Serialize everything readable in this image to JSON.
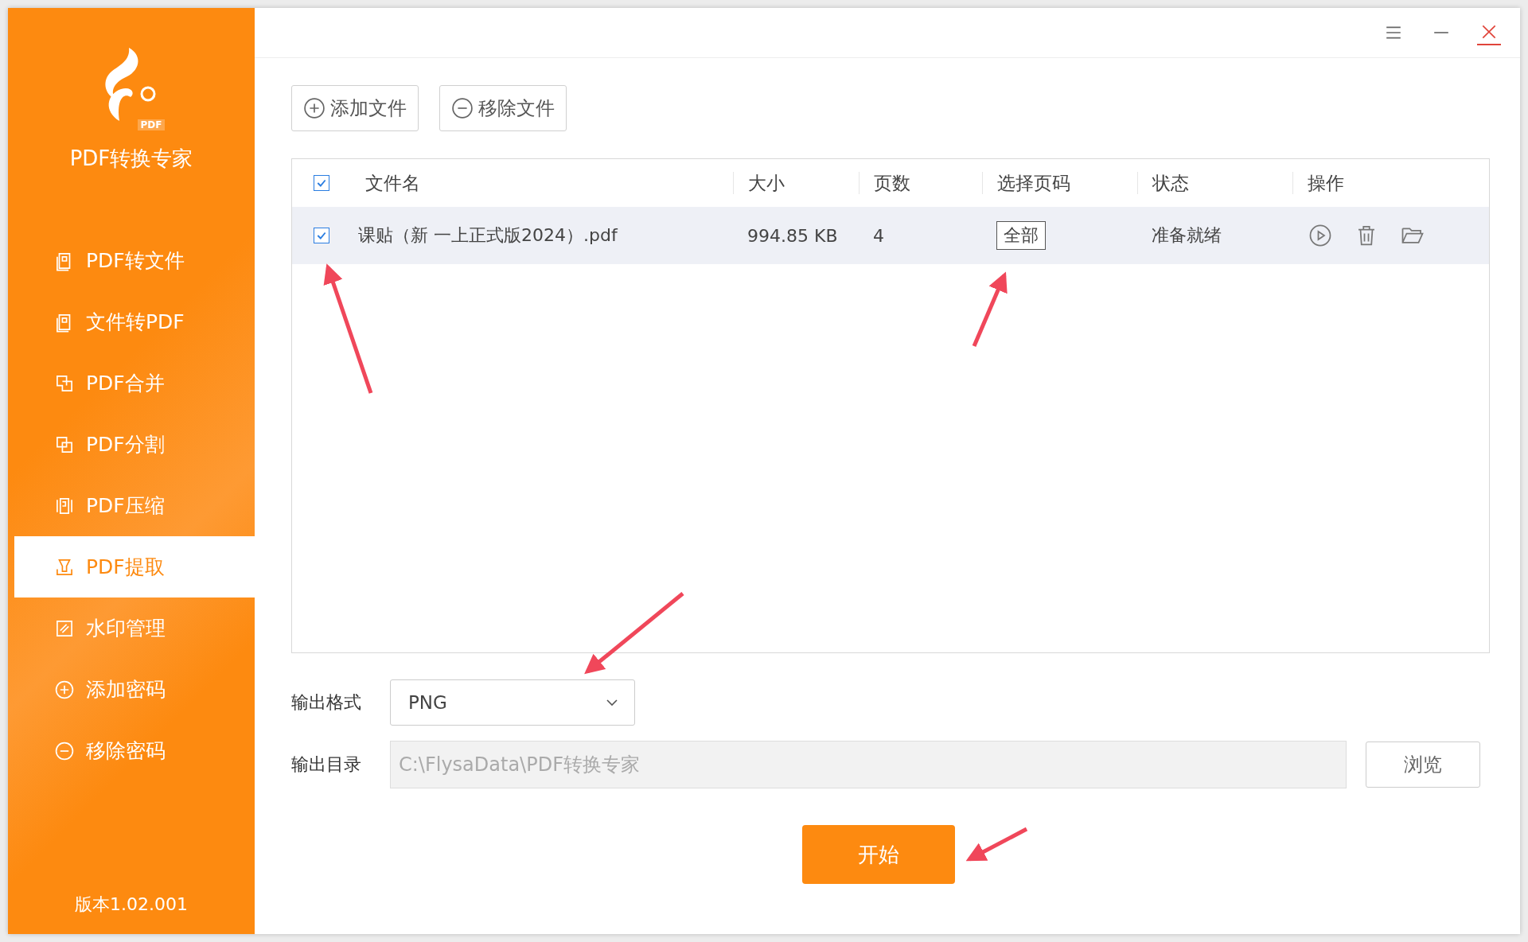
{
  "app": {
    "name": "PDF转换专家",
    "logo_badge": "PDF",
    "version": "版本1.02.001"
  },
  "sidebar": {
    "items": [
      {
        "label": "PDF转文件",
        "kind": "doc",
        "selected": false
      },
      {
        "label": "文件转PDF",
        "kind": "doc",
        "selected": false
      },
      {
        "label": "PDF合并",
        "kind": "merge",
        "selected": false
      },
      {
        "label": "PDF分割",
        "kind": "split",
        "selected": false
      },
      {
        "label": "PDF压缩",
        "kind": "compress",
        "selected": false
      },
      {
        "label": "PDF提取",
        "kind": "extract",
        "selected": true
      },
      {
        "label": "水印管理",
        "kind": "watermark",
        "selected": false
      },
      {
        "label": "添加密码",
        "kind": "plus",
        "selected": false
      },
      {
        "label": "移除密码",
        "kind": "minus",
        "selected": false
      }
    ]
  },
  "toolbar": {
    "buttons": [
      {
        "label": "添加文件",
        "kind": "plus"
      },
      {
        "label": "移除文件",
        "kind": "minus"
      }
    ]
  },
  "table": {
    "header_checked": true,
    "columns": [
      "文件名",
      "大小",
      "页数",
      "选择页码",
      "状态",
      "操作"
    ],
    "rows": [
      {
        "checked": true,
        "file": "课贴（新 一上正式版2024）.pdf",
        "size": "994.85 KB",
        "pages": "4",
        "page_range": "全部",
        "status": "准备就绪"
      }
    ]
  },
  "output": {
    "format_label": "输出格式",
    "format": "PNG",
    "dir_label": "输出目录",
    "dir": "C:\\FlysaData\\PDF转换专家",
    "browse": "浏览"
  },
  "start_button": "开始"
}
